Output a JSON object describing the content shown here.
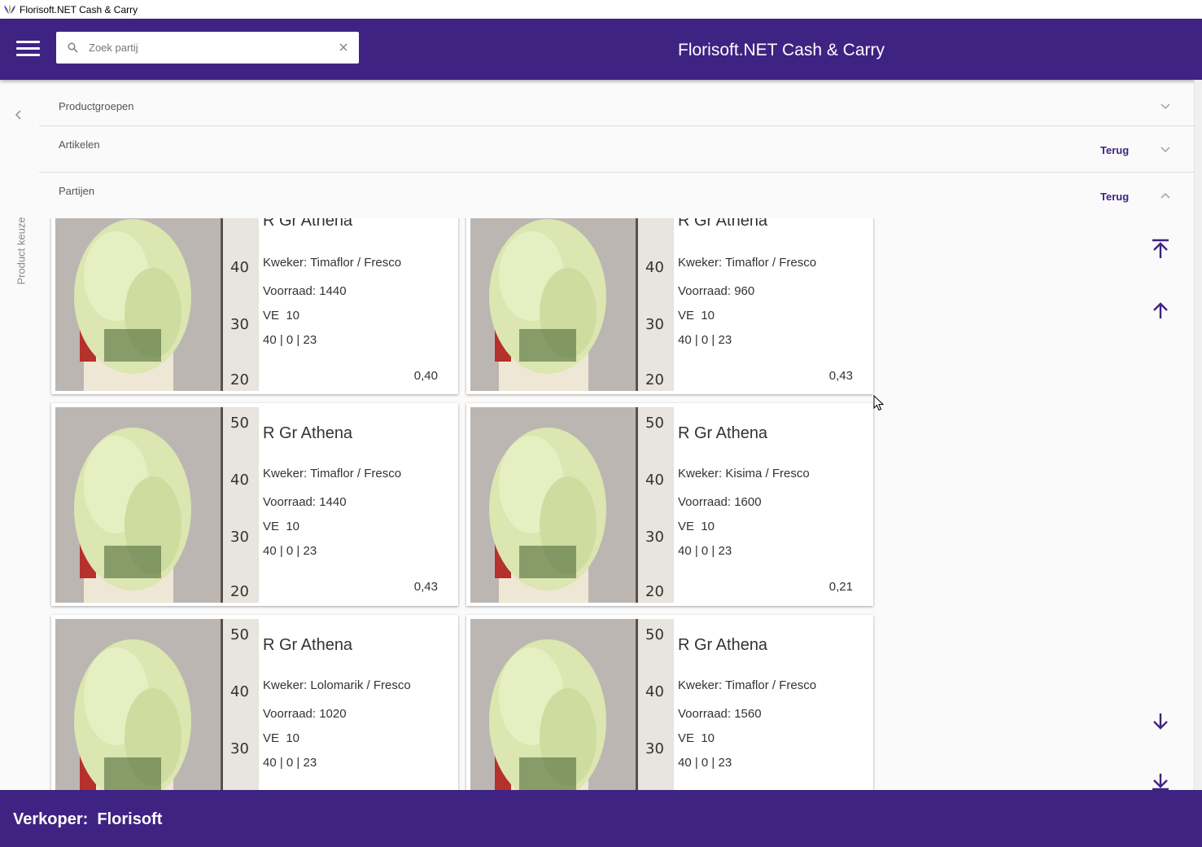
{
  "window": {
    "title": "Florisoft.NET Cash & Carry"
  },
  "header": {
    "title": "Florisoft.NET Cash & Carry",
    "search_placeholder": "Zoek partij",
    "search_value": ""
  },
  "side": {
    "label": "Product keuze"
  },
  "sections": [
    {
      "title": "Productgroepen",
      "back_label": "",
      "expanded": false
    },
    {
      "title": "Artikelen",
      "back_label": "Terug",
      "expanded": false
    },
    {
      "title": "Partijen",
      "back_label": "Terug",
      "expanded": true
    }
  ],
  "cards": [
    {
      "name": "R Gr Athena",
      "grower": "Kweker: Timaflor / Fresco",
      "stock": "Voorraad: 1440",
      "ve": "VE  10",
      "specs": "40 | 0 | 23",
      "price": "0,40"
    },
    {
      "name": "R Gr Athena",
      "grower": "Kweker: Timaflor / Fresco",
      "stock": "Voorraad: 960",
      "ve": "VE  10",
      "specs": "40 | 0 | 23",
      "price": "0,43"
    },
    {
      "name": "R Gr Athena",
      "grower": "Kweker: Timaflor / Fresco",
      "stock": "Voorraad: 1440",
      "ve": "VE  10",
      "specs": "40 | 0 | 23",
      "price": "0,43"
    },
    {
      "name": "R Gr Athena",
      "grower": "Kweker: Kisima / Fresco",
      "stock": "Voorraad: 1600",
      "ve": "VE  10",
      "specs": "40 | 0 | 23",
      "price": "0,21"
    },
    {
      "name": "R Gr Athena",
      "grower": "Kweker: Lolomarik / Fresco",
      "stock": "Voorraad: 1020",
      "ve": "VE  10",
      "specs": "40 | 0 | 23",
      "price": ""
    },
    {
      "name": "R Gr Athena",
      "grower": "Kweker: Timaflor / Fresco",
      "stock": "Voorraad: 1560",
      "ve": "VE  10",
      "specs": "40 | 0 | 23",
      "price": ""
    }
  ],
  "footer": {
    "seller": "Verkoper:  Florisoft"
  },
  "colors": {
    "primary": "#3f2383",
    "background": "#fafafa",
    "card": "#ffffff"
  },
  "icons": [
    "menu-icon",
    "search-icon",
    "clear-icon",
    "chevron-left-icon",
    "chevron-down-icon",
    "chevron-up-icon",
    "scroll-top-icon",
    "arrow-up-icon",
    "arrow-down-icon",
    "scroll-bottom-icon"
  ]
}
